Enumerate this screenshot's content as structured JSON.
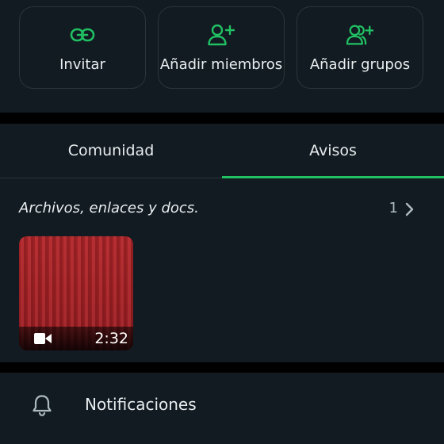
{
  "actions": [
    {
      "label": "Invitar",
      "icon": "link-icon"
    },
    {
      "label": "Añadir miembros",
      "icon": "add-person-icon"
    },
    {
      "label": "Añadir grupos",
      "icon": "add-group-icon"
    }
  ],
  "tabs": [
    {
      "label": "Comunidad",
      "active": false
    },
    {
      "label": "Avisos",
      "active": true
    }
  ],
  "media": {
    "title": "Archivos, enlaces y docs.",
    "count": "1",
    "video_duration": "2:32"
  },
  "notifications": {
    "label": "Notificaciones"
  },
  "colors": {
    "accent": "#21c063",
    "background": "#111b21",
    "divider": "#000000",
    "text": "#e9edef"
  }
}
